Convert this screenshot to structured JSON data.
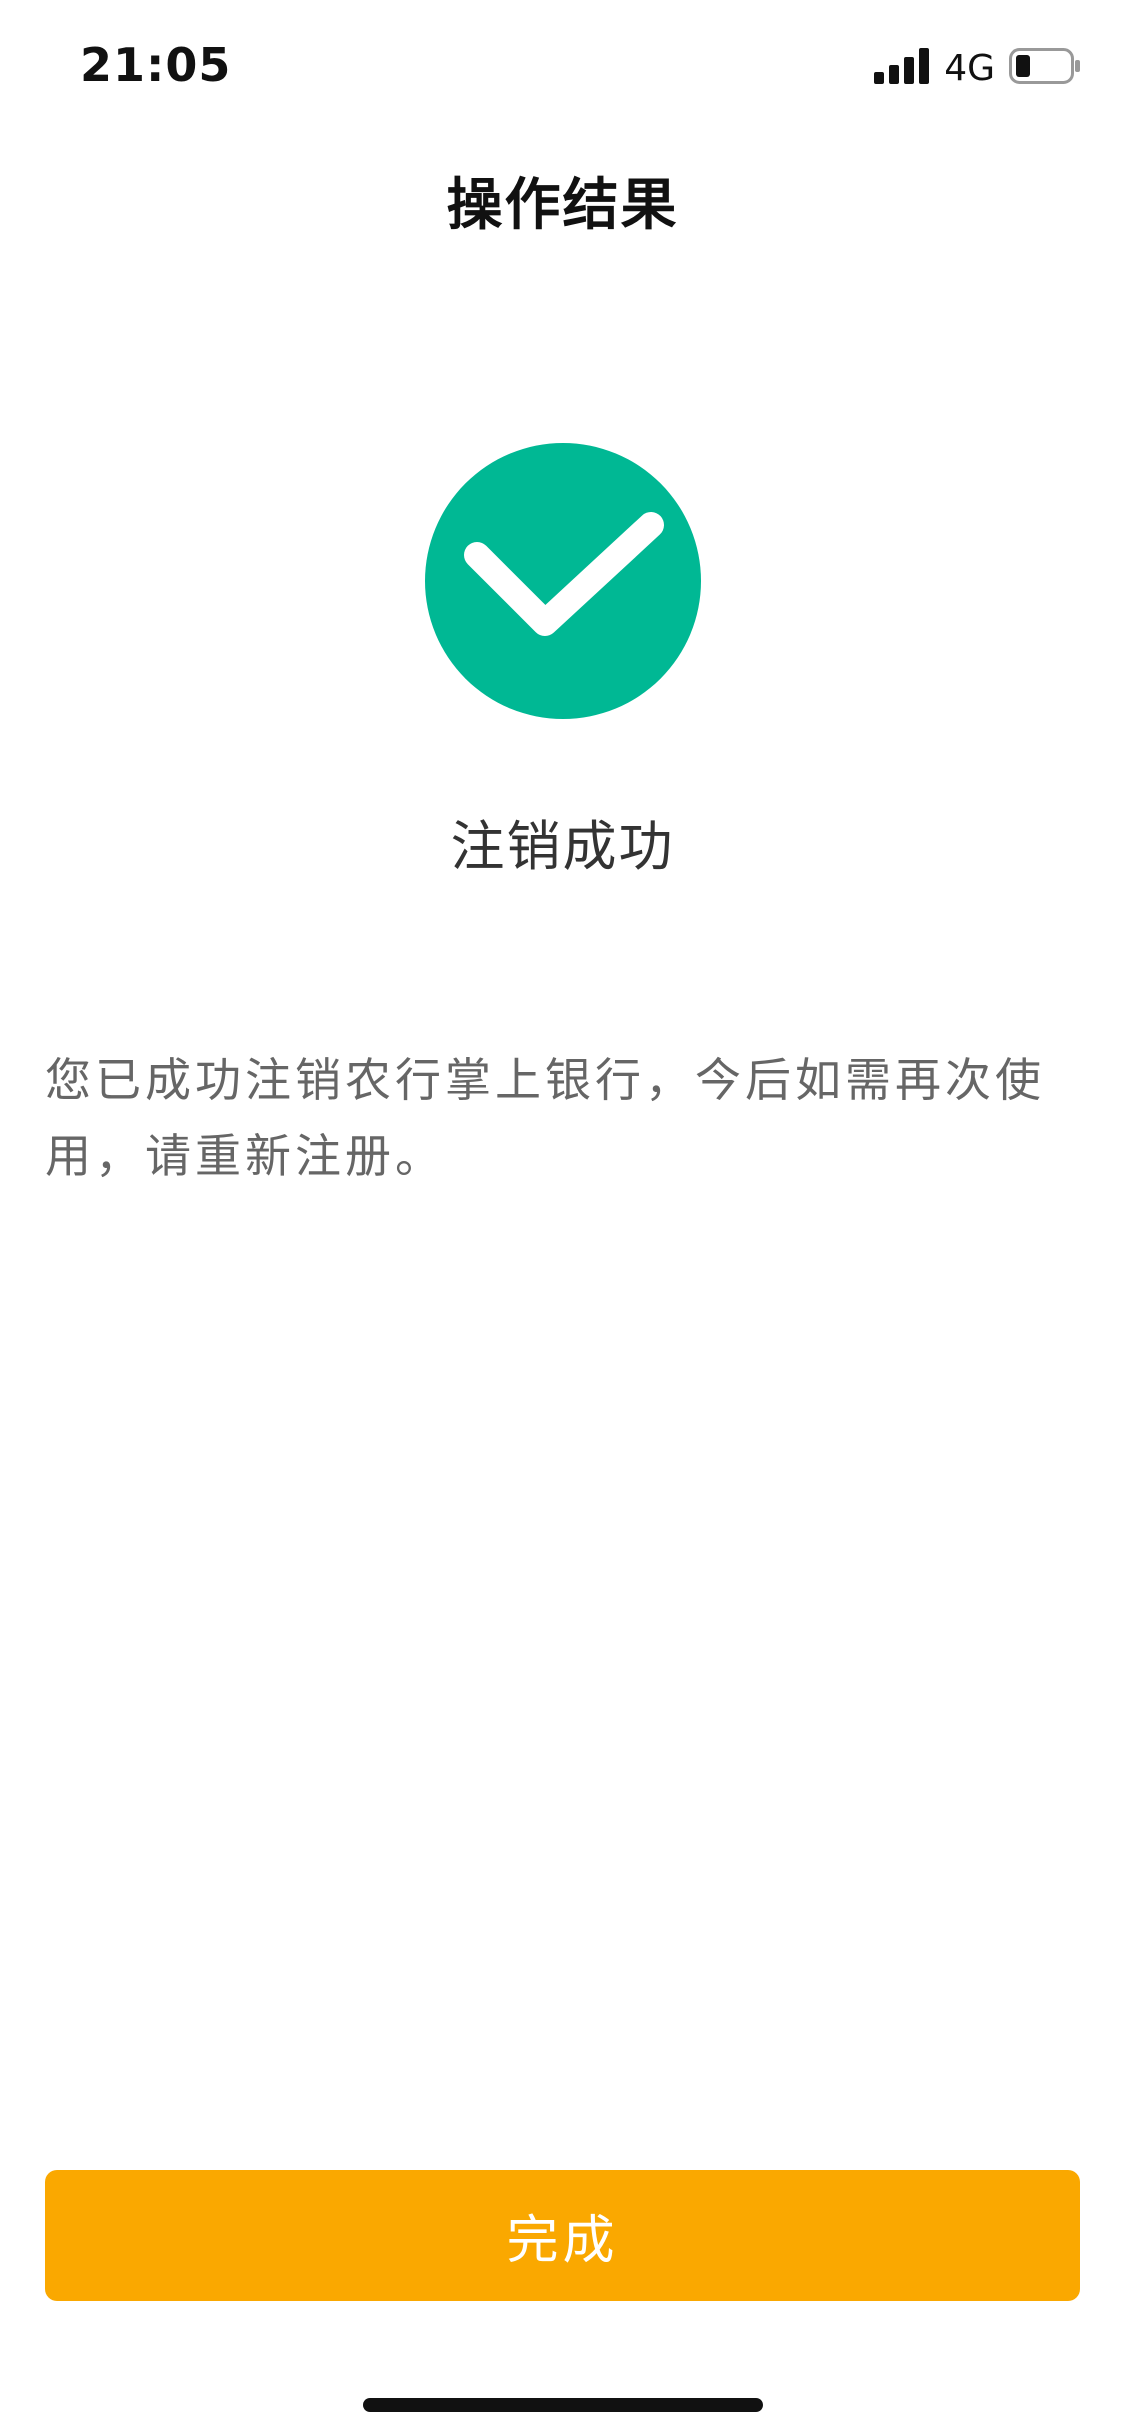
{
  "status_bar": {
    "time": "21:05",
    "network": "4G",
    "signal_icon": "cellular-signal-icon",
    "battery_icon": "battery-low-icon"
  },
  "nav": {
    "title": "操作结果"
  },
  "result": {
    "icon": "check-circle-icon",
    "icon_color": "#00B894",
    "title": "注销成功",
    "message": "您已成功注销农行掌上银行，今后如需再次使用，请重新注册。"
  },
  "actions": {
    "done_label": "完成",
    "button_color": "#FAA800"
  }
}
